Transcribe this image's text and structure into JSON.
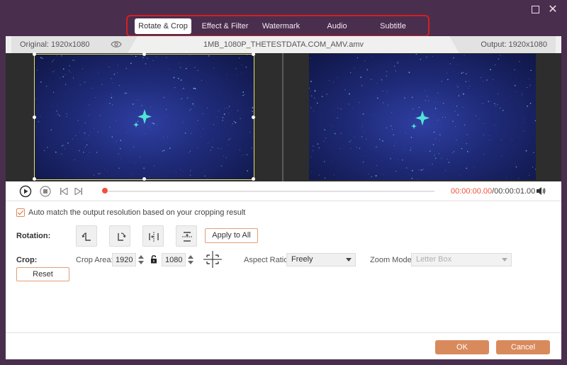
{
  "window": {
    "maximize_icon": "maximize-icon",
    "close_glyph": "✕"
  },
  "tabs": [
    {
      "label": "Rotate & Crop",
      "active": true
    },
    {
      "label": "Effect & Filter",
      "active": false
    },
    {
      "label": "Watermark",
      "active": false
    },
    {
      "label": "Audio",
      "active": false
    },
    {
      "label": "Subtitle",
      "active": false
    }
  ],
  "infobar": {
    "original": "Original: 1920x1080",
    "filename": "1MB_1080P_THETESTDATA.COM_AMV.amv",
    "output": "Output: 1920x1080"
  },
  "playback": {
    "current_time": "00:00:00.00",
    "total_time": "/00:00:01.00",
    "progress": 0.0
  },
  "options": {
    "auto_match_label": "Auto match the output resolution based on your cropping result",
    "auto_match_checked": true
  },
  "rotation": {
    "label": "Rotation:",
    "apply_all": "Apply to All"
  },
  "crop": {
    "label": "Crop:",
    "area_label": "Crop Area:",
    "width": "1920",
    "height": "1080",
    "aspect_label": "Aspect Ratio:",
    "aspect_value": "Freely",
    "zoom_label": "Zoom Mode:",
    "zoom_value": "Letter Box",
    "reset": "Reset"
  },
  "footer": {
    "ok": "OK",
    "cancel": "Cancel"
  },
  "colors": {
    "accent": "#d98a5c",
    "tab_highlight": "#d42020",
    "window_bg": "#4a2e4e",
    "time_accent": "#f0503c"
  }
}
